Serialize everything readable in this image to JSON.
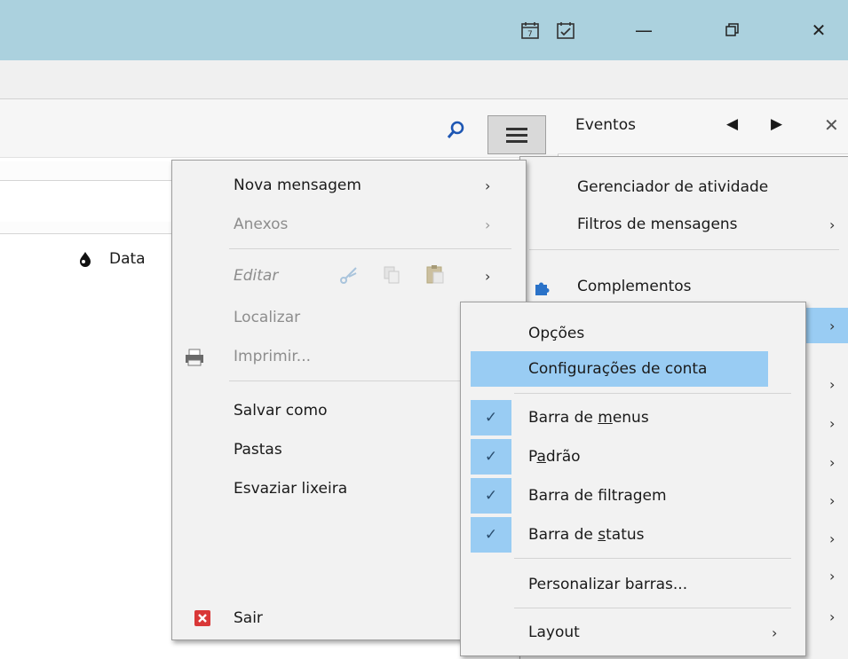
{
  "titlebar": {
    "calendar_icon": "calendar-icon",
    "tasks_icon": "tasks-icon",
    "minimize": "—",
    "restore": "⧉",
    "close": "✕"
  },
  "side_header": {
    "title": "Eventos",
    "prev": "◀",
    "next": "▶",
    "close": "✕"
  },
  "columns": {
    "junk_icon": "junk-icon",
    "date": "Data"
  },
  "main_menu": {
    "items": [
      {
        "label": "Nova mensagem",
        "arrow": "›"
      },
      {
        "label": "Anexos",
        "arrow": "›"
      },
      {
        "label": "Editar",
        "arrow": "›"
      },
      {
        "label": "Localizar",
        "arrow": ""
      },
      {
        "label": "Imprimir...",
        "arrow": ""
      },
      {
        "label": "Salvar como",
        "arrow": ""
      },
      {
        "label": "Pastas",
        "arrow": ""
      },
      {
        "label": "Esvaziar lixeira",
        "arrow": ""
      },
      {
        "label": "Sair",
        "arrow": ""
      }
    ]
  },
  "right_menu": {
    "items": [
      {
        "label": "Gerenciador de atividade",
        "arrow": ""
      },
      {
        "label": "Filtros de mensagens",
        "arrow": "›"
      },
      {
        "label": "Complementos",
        "arrow": ""
      }
    ],
    "extra_arrows": [
      "›",
      "›",
      "›",
      "›",
      "›",
      "›",
      "›",
      "›"
    ]
  },
  "sub_menu": {
    "items": [
      {
        "label": "Opções"
      },
      {
        "label": "Configurações de conta"
      },
      {
        "pre": "Barra de ",
        "ul": "m",
        "post": "enus",
        "checked": true
      },
      {
        "pre": "P",
        "ul": "a",
        "post": "drão",
        "checked": true
      },
      {
        "pre": "Barra de filtragem",
        "ul": "",
        "post": "",
        "checked": true
      },
      {
        "pre": "Barra de ",
        "ul": "s",
        "post": "tatus",
        "checked": true
      },
      {
        "label": "Personalizar barras..."
      },
      {
        "label": "Layout",
        "arrow": "›"
      }
    ],
    "check_glyph": "✓"
  },
  "colors": {
    "titlebar": "#abd1de",
    "highlight": "#99ccf3",
    "menu_bg": "#f2f2f2"
  }
}
